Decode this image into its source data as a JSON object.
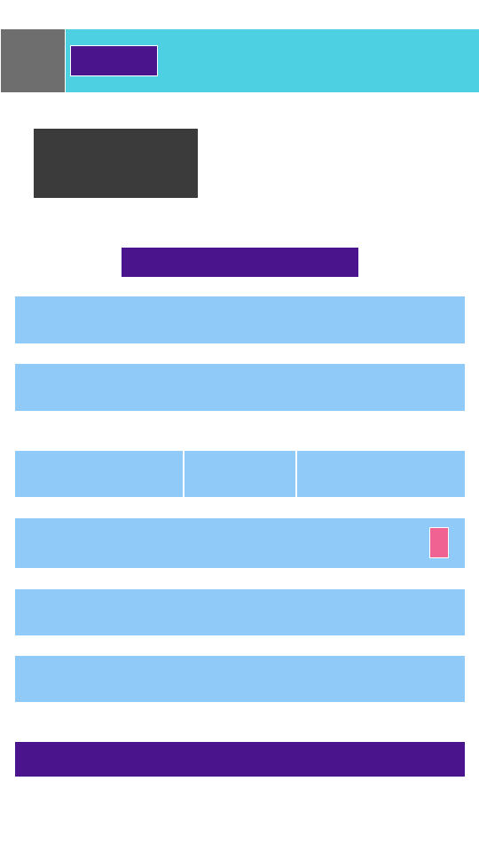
{
  "colors": {
    "header_icon": "#6e6e6e",
    "header_bar": "#4dd0e1",
    "accent": "#4a148c",
    "preview": "#3b3b3b",
    "field": "#90caf9",
    "toggle": "#f06292"
  },
  "icons": {
    "header": "app-icon",
    "preview": "image-placeholder-icon"
  }
}
